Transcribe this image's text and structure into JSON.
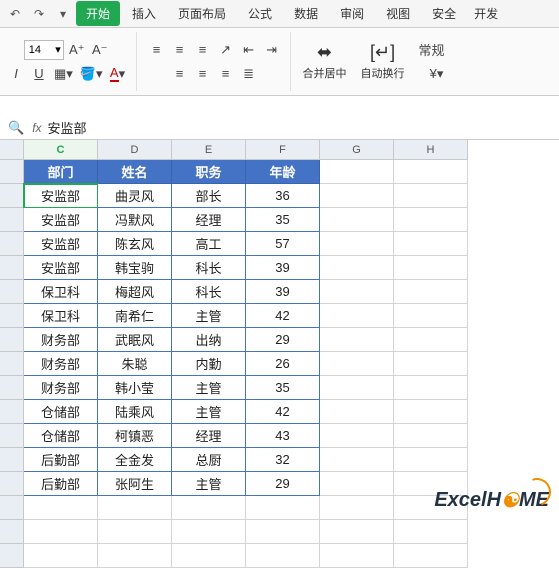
{
  "qat": {
    "undo": "↶",
    "redo": "↷",
    "dropdown": "▾"
  },
  "tabs": {
    "start": "开始",
    "insert": "插入",
    "layout": "页面布局",
    "formula": "公式",
    "data": "数据",
    "review": "审阅",
    "view": "视图",
    "security": "安全",
    "dev": "开发"
  },
  "ribbon": {
    "font_size": "14",
    "merge_label": "合并居中",
    "wrap_label": "自动换行",
    "general_label": "常规"
  },
  "formula_bar": {
    "value": "安监部"
  },
  "cols": [
    "C",
    "D",
    "E",
    "F",
    "G",
    "H"
  ],
  "active_col_index": 0,
  "header": {
    "c": "部门",
    "d": "姓名",
    "e": "职务",
    "f": "年龄"
  },
  "rows": [
    {
      "c": "安监部",
      "d": "曲灵风",
      "e": "部长",
      "f": "36"
    },
    {
      "c": "安监部",
      "d": "冯默风",
      "e": "经理",
      "f": "35"
    },
    {
      "c": "安监部",
      "d": "陈玄风",
      "e": "高工",
      "f": "57"
    },
    {
      "c": "安监部",
      "d": "韩宝驹",
      "e": "科长",
      "f": "39"
    },
    {
      "c": "保卫科",
      "d": "梅超风",
      "e": "科长",
      "f": "39"
    },
    {
      "c": "保卫科",
      "d": "南希仁",
      "e": "主管",
      "f": "42"
    },
    {
      "c": "财务部",
      "d": "武眠风",
      "e": "出纳",
      "f": "29"
    },
    {
      "c": "财务部",
      "d": "朱聪",
      "e": "内勤",
      "f": "26"
    },
    {
      "c": "财务部",
      "d": "韩小莹",
      "e": "主管",
      "f": "35"
    },
    {
      "c": "仓储部",
      "d": "陆乘风",
      "e": "主管",
      "f": "42"
    },
    {
      "c": "仓储部",
      "d": "柯镇恶",
      "e": "经理",
      "f": "43"
    },
    {
      "c": "后勤部",
      "d": "全金发",
      "e": "总厨",
      "f": "32"
    },
    {
      "c": "后勤部",
      "d": "张阿生",
      "e": "主管",
      "f": "29"
    }
  ],
  "watermark": {
    "t1": "Excel",
    "t2": "H",
    "t3": "ME"
  }
}
